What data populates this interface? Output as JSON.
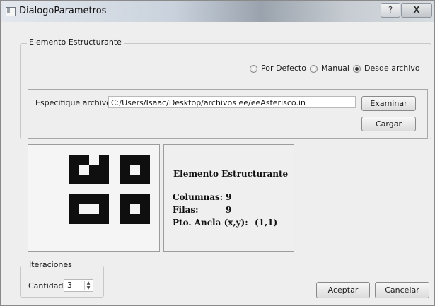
{
  "window": {
    "title": "DialogoParametros",
    "help_label": "?",
    "close_label": "X"
  },
  "structuring_element_group": {
    "title": "Elemento Estructurante",
    "radios": [
      {
        "label": "Por Defecto",
        "checked": false
      },
      {
        "label": "Manual",
        "checked": false
      },
      {
        "label": "Desde archivo",
        "checked": true
      }
    ],
    "file": {
      "label": "Especifique archivo:",
      "value": "C:/Users/Isaac/Desktop/archivos ee/eeAsterisco.in",
      "browse_label": "Examinar",
      "load_label": "Cargar"
    }
  },
  "info": {
    "title": "Elemento Estructurante",
    "columns_label": "Columnas:",
    "columns_value": "9",
    "rows_label": "Filas:",
    "rows_value": "9",
    "anchor_label": "Pto. Ancla (x,y):",
    "anchor_value": "(1,1)"
  },
  "iterations": {
    "title": "Iteraciones",
    "quantity_label": "Cantidad:",
    "quantity_value": "3"
  },
  "footer": {
    "accept_label": "Aceptar",
    "cancel_label": "Cancelar"
  }
}
